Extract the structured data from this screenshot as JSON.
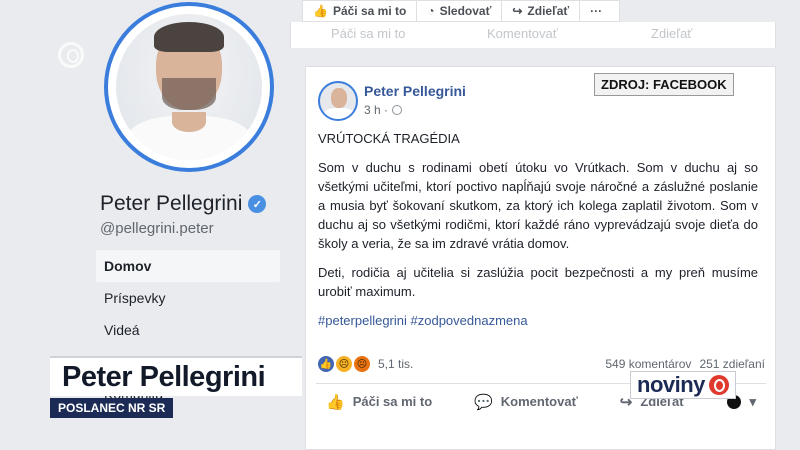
{
  "profile": {
    "name": "Peter Pellegrini",
    "handle": "@pellegrini.peter"
  },
  "nav": {
    "items": [
      {
        "label": "Domov"
      },
      {
        "label": "Príspevky"
      },
      {
        "label": "Videá"
      },
      {
        "label": "Komunita"
      }
    ]
  },
  "top_bar": {
    "like_label": "Páči sa mi to",
    "follow_label": "Sledovať",
    "share_label": "Zdieľať",
    "more_label": "···"
  },
  "prev_post": {
    "ghost_like": "Páči sa mi to",
    "ghost_comment": "Komentovať",
    "ghost_share": "Zdieľať"
  },
  "post": {
    "author": "Peter Pellegrini",
    "time": "3 h ·",
    "heading": "VRÚTOCKÁ TRAGÉDIA",
    "paragraph1": "Som v duchu s rodinami obetí útoku vo Vrútkach. Som v duchu aj so všetkými učiteľmi, ktorí poctivo napĺňajú svoje náročné a záslužné poslanie a musia byť šokovaní skutkom, za ktorý ich kolega zaplatil životom. Som v duchu aj so všetkými rodičmi, ktorí každé ráno vyprevádzajú svoje dieťa do školy a veria, že sa im zdravé vrátia domov.",
    "paragraph2": "Deti, rodičia aj učitelia si zaslúžia pocit bezpečnosti a my preň musíme urobiť maximum.",
    "hashtags": "#peterpellegrini #zodpovednazmena",
    "reaction_count": "5,1 tis.",
    "comments": "549 komentárov",
    "shares": "251 zdieľaní",
    "like_label": "Páči sa mi to",
    "comment_label": "Komentovať",
    "share_label": "Zdieľať"
  },
  "overlay": {
    "source": "ZDROJ: FACEBOOK",
    "lower_third_name": "Peter Pellegrini",
    "lower_third_title": "POSLANEC NR SR",
    "channel_logo": "noviny"
  },
  "colors": {
    "facebook_blue": "#365899",
    "verified": "#4a90e2",
    "tv_navy": "#1b2b55",
    "tv_red": "#e03a2e"
  }
}
